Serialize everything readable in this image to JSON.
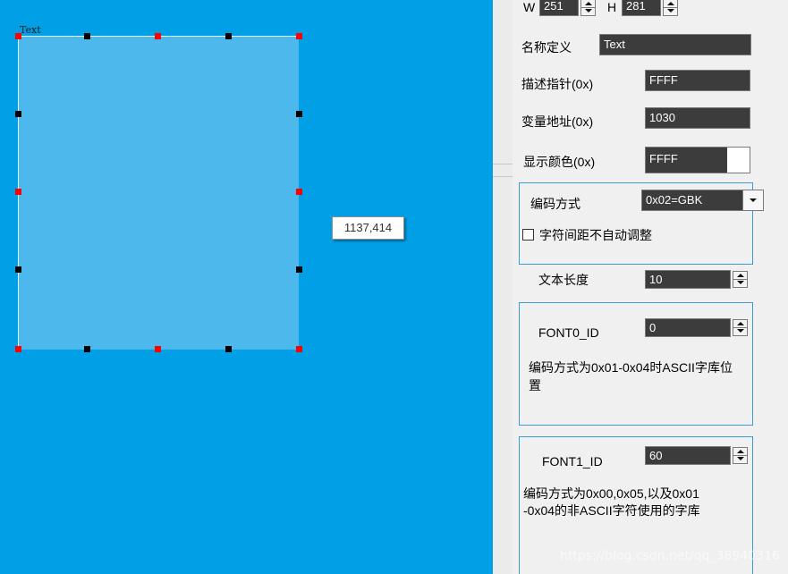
{
  "canvas": {
    "widget_caption": "Text",
    "tooltip": "1137,414"
  },
  "panel": {
    "size": {
      "w_label": "W",
      "w_value": "251",
      "h_label": "H",
      "h_value": "281"
    },
    "name": {
      "label": "名称定义",
      "value": "Text"
    },
    "desc_pointer": {
      "label": "描述指针(0x)",
      "value": "FFFF"
    },
    "var_address": {
      "label": "变量地址(0x)",
      "value": "1030"
    },
    "display_color": {
      "label": "显示颜色(0x)",
      "value": "FFFF",
      "swatch_color": "#ffffff"
    },
    "encoding": {
      "label": "编码方式",
      "selected": "0x02=GBK",
      "checkbox_label": "字符间距不自动调整",
      "checkbox_checked": false
    },
    "text_length": {
      "label": "文本长度",
      "value": "10"
    },
    "font0": {
      "label": "FONT0_ID",
      "value": "0",
      "description": "编码方式为0x01-0x04时ASCII字库位置"
    },
    "font1": {
      "label": "FONT1_ID",
      "value": "60",
      "description_line1": "编码方式为0x00,0x05,以及0x01",
      "description_line2": "-0x04的非ASCII字符使用的字库"
    }
  },
  "watermark": "https://blog.csdn.net/qq_38940316",
  "colors": {
    "canvas_bg": "#009fe6",
    "widget_fill": "#4db8ec",
    "field_bg": "#3c3c3c",
    "group_border": "#3a9bd5",
    "handle_red": "#ff0000",
    "handle_black": "#000000"
  },
  "icons": {
    "spin_up": "triangle-up-icon",
    "spin_down": "triangle-down-icon",
    "dropdown": "chevron-down-icon"
  }
}
